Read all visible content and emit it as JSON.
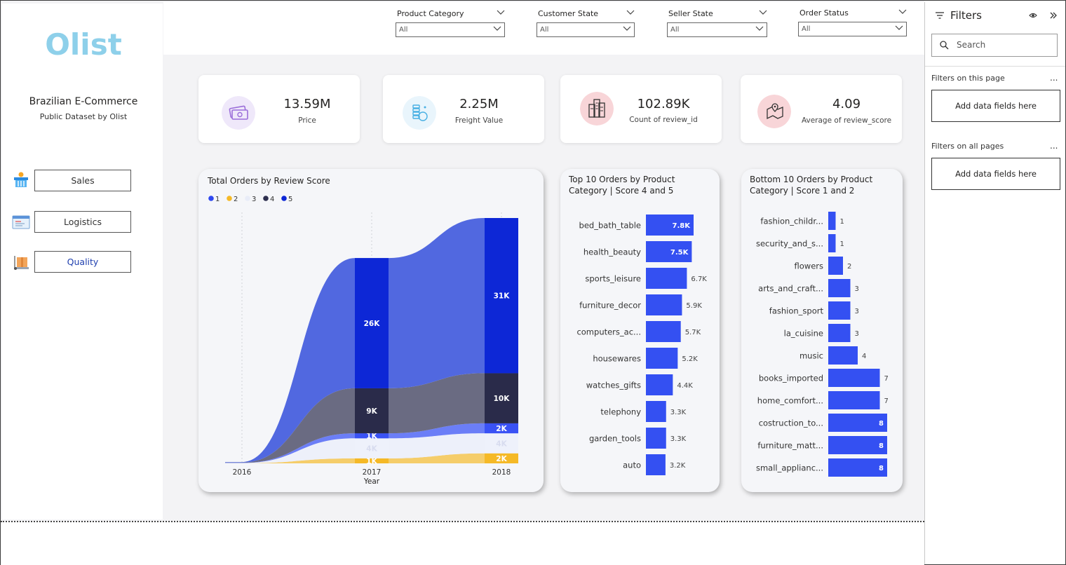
{
  "brand": {
    "logo": "Olist",
    "title": "Brazilian E-Commerce",
    "subtitle": "Public Dataset by Olist"
  },
  "nav": {
    "items": [
      {
        "label": "Sales",
        "icon": "basket-icon"
      },
      {
        "label": "Logistics",
        "icon": "shipping-icon"
      },
      {
        "label": "Quality",
        "icon": "package-icon"
      }
    ],
    "active": "Quality"
  },
  "slicers": [
    {
      "label": "Product Category",
      "value": "All"
    },
    {
      "label": "Customer State",
      "value": "All"
    },
    {
      "label": "Seller State",
      "value": "All"
    },
    {
      "label": "Order Status",
      "value": "All"
    }
  ],
  "kpis": [
    {
      "value": "13.59M",
      "label": "Price",
      "icon": "money-icon",
      "icon_bg": "#efe8fa"
    },
    {
      "value": "2.25M",
      "label": "Freight Value",
      "icon": "coins-icon",
      "icon_bg": "#e9f5fc"
    },
    {
      "value": "102.89K",
      "label": "Count of review_id",
      "icon": "buildings-icon",
      "icon_bg": "#f8d5d8"
    },
    {
      "value": "4.09",
      "label": "Average of review_score",
      "icon": "map-pin-icon",
      "icon_bg": "#f8d5d8"
    }
  ],
  "filters_pane": {
    "title": "Filters",
    "search_placeholder": "Search",
    "on_this_page": "Filters on this page",
    "on_all_pages": "Filters on all pages",
    "add_fields": "Add data fields here",
    "more": "..."
  },
  "chart_data": [
    {
      "type": "area",
      "title": "Total Orders by Review Score",
      "xlabel": "Year",
      "ylabel": "",
      "x": [
        "2016",
        "2017",
        "2018"
      ],
      "legend": [
        "1",
        "2",
        "3",
        "4",
        "5"
      ],
      "series": [
        {
          "name": "1",
          "color": "#2f48f0",
          "values": [
            0.05,
            1,
            2
          ],
          "labels": [
            "",
            "1K",
            "2K"
          ]
        },
        {
          "name": "2",
          "color": "#f5b927",
          "values": [
            0.02,
            1,
            2
          ],
          "labels": [
            "",
            "1K",
            "2K"
          ]
        },
        {
          "name": "3",
          "color": "#e8ecf8",
          "values": [
            0.05,
            4,
            4
          ],
          "labels": [
            "",
            "4K",
            "4K"
          ]
        },
        {
          "name": "4",
          "color": "#2d2f4e",
          "values": [
            0.05,
            9,
            10
          ],
          "labels": [
            "",
            "9K",
            "10K"
          ]
        },
        {
          "name": "5",
          "color": "#0d27d6",
          "values": [
            0.1,
            26,
            31
          ],
          "labels": [
            "",
            "26K",
            "31K"
          ]
        }
      ],
      "band_order": [
        "2",
        "3",
        "1",
        "4",
        "5"
      ],
      "band_colors": {
        "1": "#6b7ef7",
        "2": "#f5cd6a",
        "3": "#edf0fa",
        "4": "#6a6b82",
        "5": "#5168e0"
      },
      "highlight_colors": {
        "1": "#3a52f5",
        "2": "#f5b927",
        "3": "#eef1fb",
        "4": "#2a2b4a",
        "5": "#0d27d6"
      }
    },
    {
      "type": "bar",
      "title": "Top 10 Orders by Product Category | Score 4 and 5",
      "categories": [
        "bed_bath_table",
        "health_beauty",
        "sports_leisure",
        "furniture_decor",
        "computers_ac...",
        "housewares",
        "watches_gifts",
        "telephony",
        "garden_tools",
        "auto"
      ],
      "values": [
        7.8,
        7.5,
        6.7,
        5.9,
        5.7,
        5.2,
        4.4,
        3.3,
        3.3,
        3.2
      ],
      "labels": [
        "7.8K",
        "7.5K",
        "6.7K",
        "5.9K",
        "5.7K",
        "5.2K",
        "4.4K",
        "3.3K",
        "3.3K",
        "3.2K"
      ],
      "color": "#3450f2"
    },
    {
      "type": "bar",
      "title": "Bottom 10 Orders by Product Category | Score 1 and 2",
      "categories": [
        "fashion_childr...",
        "security_and_s...",
        "flowers",
        "arts_and_craft...",
        "fashion_sport",
        "la_cuisine",
        "music",
        "books_imported",
        "home_comfort...",
        "costruction_to...",
        "furniture_matt...",
        "small_applianc..."
      ],
      "values": [
        1,
        1,
        2,
        3,
        3,
        3,
        4,
        7,
        7,
        8,
        8,
        8
      ],
      "labels": [
        "1",
        "1",
        "2",
        "3",
        "3",
        "3",
        "4",
        "7",
        "7",
        "8",
        "8",
        "8"
      ],
      "color": "#3450f2"
    }
  ]
}
